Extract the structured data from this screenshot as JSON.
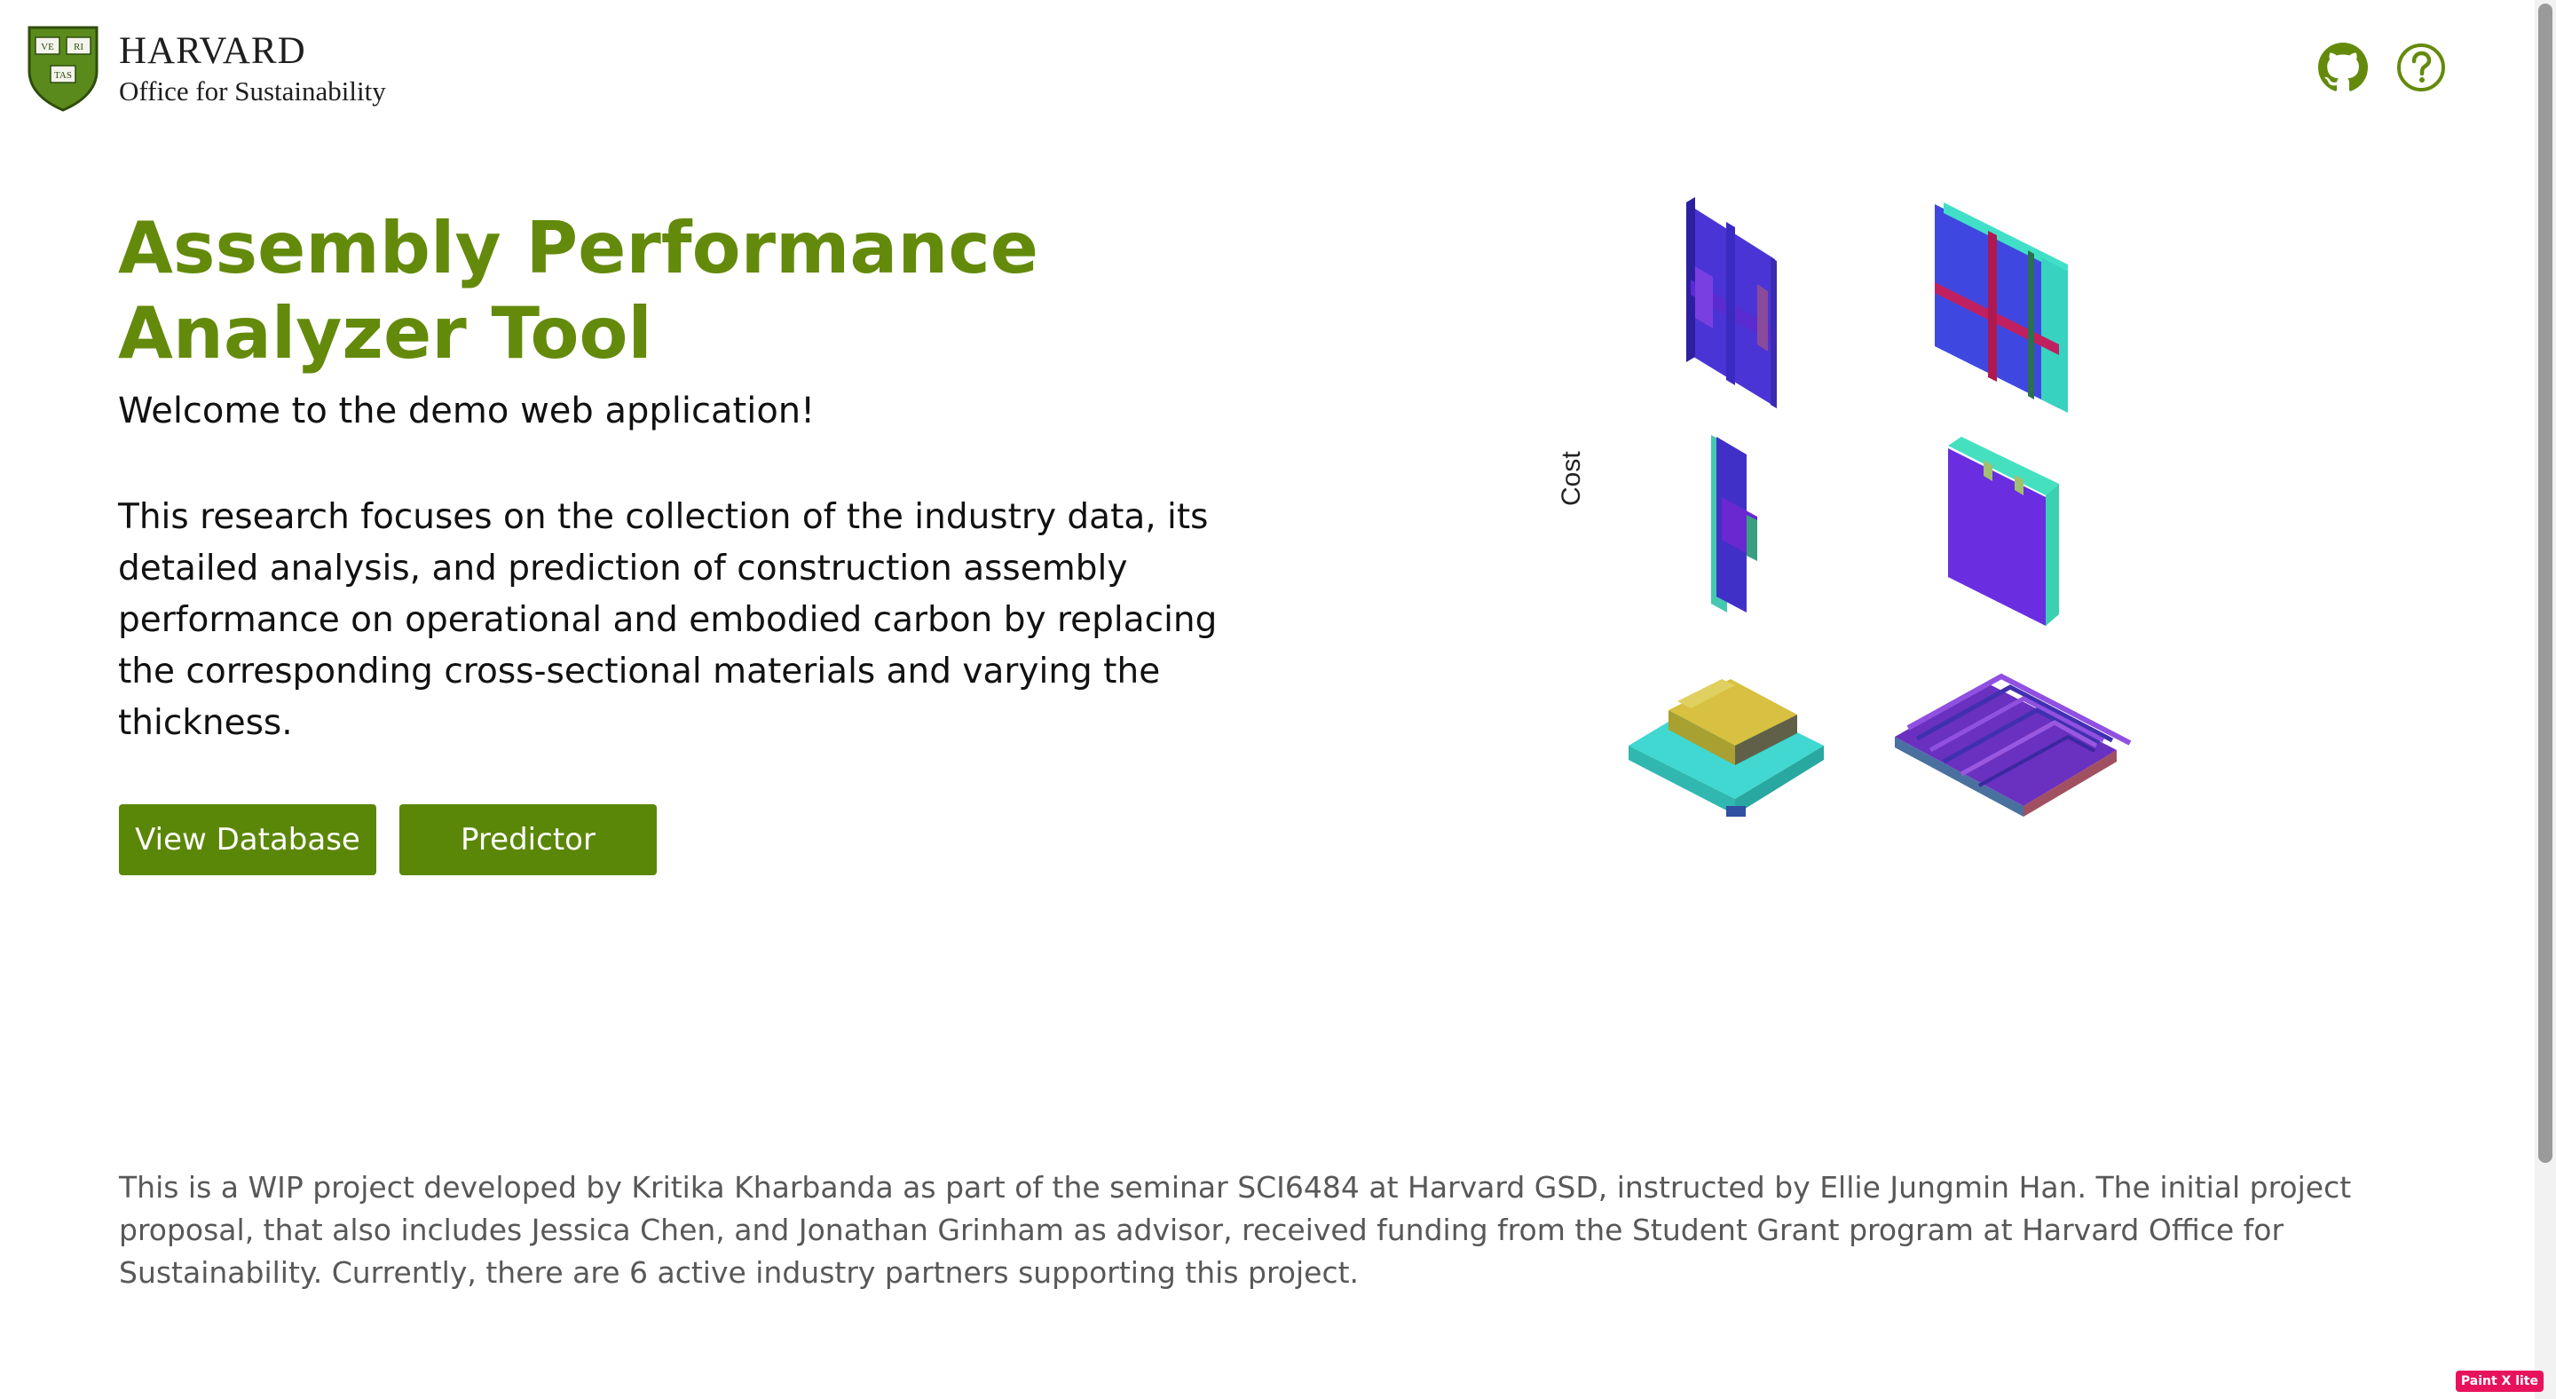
{
  "header": {
    "logo_title": "HARVARD",
    "logo_subtitle": "Office for Sustainability",
    "shield_text": [
      "VE",
      "RI",
      "TAS"
    ]
  },
  "hero": {
    "title": "Assembly Performance Analyzer Tool",
    "welcome": "Welcome to the demo web application!",
    "description": "This research focuses on the collection of the industry data, its detailed analysis, and prediction of construction assembly performance on operational and embodied carbon by replacing the corresponding cross-sectional materials and varying the thickness.",
    "buttons": {
      "database": "View Database",
      "predictor": "Predictor"
    }
  },
  "illustration": {
    "axis_label": "Cost"
  },
  "footer": {
    "text": "This is a WIP project developed by Kritika Kharbanda as part of the seminar SCI6484 at Harvard GSD, instructed by Ellie Jungmin Han. The initial project proposal, that also includes Jessica Chen, and Jonathan Grinham as advisor, received funding from the Student Grant program at Harvard Office for Sustainability. Currently, there are 6 active industry partners supporting this project."
  },
  "badge": "Paint X lite",
  "colors": {
    "brand_green": "#648a0c",
    "button_green": "#5b8708",
    "text": "#111111",
    "muted_text": "#585858"
  },
  "icons": [
    "github-icon",
    "help-icon"
  ]
}
